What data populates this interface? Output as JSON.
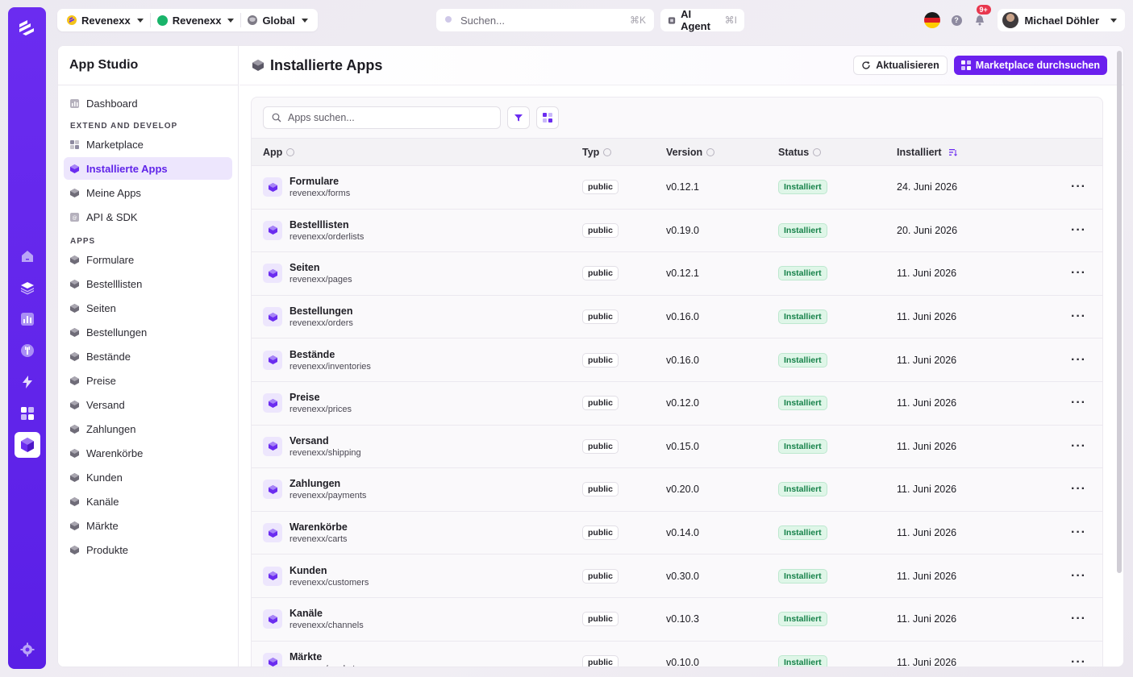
{
  "topbar": {
    "tenant1": "Revenexx",
    "tenant2": "Revenexx",
    "scope": "Global",
    "search_placeholder": "Suchen...",
    "search_shortcut": "⌘K",
    "ai_label": "AI Agent",
    "ai_shortcut": "⌘I",
    "notifications": "9+",
    "user_name": "Michael Döhler"
  },
  "sidebar": {
    "title": "App Studio",
    "dashboard": "Dashboard",
    "section_extend": "EXTEND AND DEVELOP",
    "extend_items": [
      "Marketplace",
      "Installierte Apps",
      "Meine Apps",
      "API & SDK"
    ],
    "section_apps": "APPS",
    "app_items": [
      "Formulare",
      "Bestelllisten",
      "Seiten",
      "Bestellungen",
      "Bestände",
      "Preise",
      "Versand",
      "Zahlungen",
      "Warenkörbe",
      "Kunden",
      "Kanäle",
      "Märkte",
      "Produkte"
    ]
  },
  "main": {
    "title": "Installierte Apps",
    "refresh_label": "Aktualisieren",
    "marketplace_label": "Marketplace durchsuchen",
    "search_placeholder": "Apps suchen...",
    "columns": [
      "App",
      "Typ",
      "Version",
      "Status",
      "Installiert"
    ],
    "rows": [
      {
        "name": "Formulare",
        "slug": "revenexx/forms",
        "type": "public",
        "version": "v0.12.1",
        "status": "Installiert",
        "date": "24. Juni 2026"
      },
      {
        "name": "Bestelllisten",
        "slug": "revenexx/orderlists",
        "type": "public",
        "version": "v0.19.0",
        "status": "Installiert",
        "date": "20. Juni 2026"
      },
      {
        "name": "Seiten",
        "slug": "revenexx/pages",
        "type": "public",
        "version": "v0.12.1",
        "status": "Installiert",
        "date": "11. Juni 2026"
      },
      {
        "name": "Bestellungen",
        "slug": "revenexx/orders",
        "type": "public",
        "version": "v0.16.0",
        "status": "Installiert",
        "date": "11. Juni 2026"
      },
      {
        "name": "Bestände",
        "slug": "revenexx/inventories",
        "type": "public",
        "version": "v0.16.0",
        "status": "Installiert",
        "date": "11. Juni 2026"
      },
      {
        "name": "Preise",
        "slug": "revenexx/prices",
        "type": "public",
        "version": "v0.12.0",
        "status": "Installiert",
        "date": "11. Juni 2026"
      },
      {
        "name": "Versand",
        "slug": "revenexx/shipping",
        "type": "public",
        "version": "v0.15.0",
        "status": "Installiert",
        "date": "11. Juni 2026"
      },
      {
        "name": "Zahlungen",
        "slug": "revenexx/payments",
        "type": "public",
        "version": "v0.20.0",
        "status": "Installiert",
        "date": "11. Juni 2026"
      },
      {
        "name": "Warenkörbe",
        "slug": "revenexx/carts",
        "type": "public",
        "version": "v0.14.0",
        "status": "Installiert",
        "date": "11. Juni 2026"
      },
      {
        "name": "Kunden",
        "slug": "revenexx/customers",
        "type": "public",
        "version": "v0.30.0",
        "status": "Installiert",
        "date": "11. Juni 2026"
      },
      {
        "name": "Kanäle",
        "slug": "revenexx/channels",
        "type": "public",
        "version": "v0.10.3",
        "status": "Installiert",
        "date": "11. Juni 2026"
      },
      {
        "name": "Märkte",
        "slug": "revenexx/markets",
        "type": "public",
        "version": "v0.10.0",
        "status": "Installiert",
        "date": "11. Juni 2026"
      }
    ]
  },
  "colors": {
    "brand": "#6b20ee",
    "status_green": "#17824a"
  }
}
